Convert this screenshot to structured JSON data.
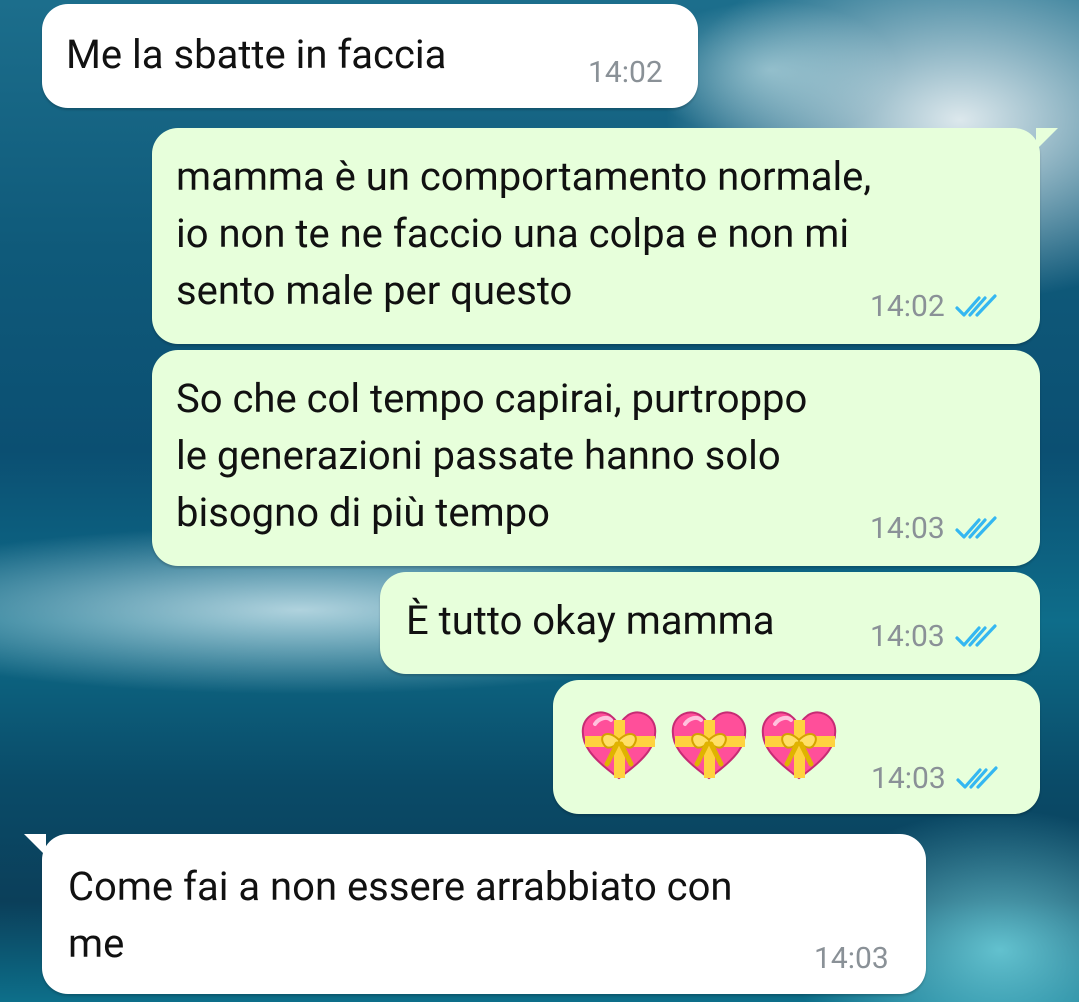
{
  "messages": [
    {
      "text": "Me la sbatte in faccia",
      "time": "14:02"
    },
    {
      "text": "mamma è un comportamento normale,\nio non te ne faccio una colpa e non mi\nsento male per questo",
      "time": "14:02"
    },
    {
      "text": "So che col tempo capirai, purtroppo\nle generazioni passate hanno solo\nbisogno di più tempo",
      "time": "14:03"
    },
    {
      "text": "È tutto okay mamma",
      "time": "14:03"
    },
    {
      "emoji": [
        "heart-with-ribbon",
        "heart-with-ribbon",
        "heart-with-ribbon"
      ],
      "time": "14:03"
    },
    {
      "text": "Come fai a non essere arrabbiato con\nme",
      "time": "14:03"
    }
  ],
  "colors": {
    "incoming_bubble": "#ffffff",
    "outgoing_bubble": "#e7ffdb",
    "read_ticks": "#34b7f1",
    "timestamp": "#8a9197"
  },
  "icons": {
    "read_receipt": "double-check-icon"
  }
}
